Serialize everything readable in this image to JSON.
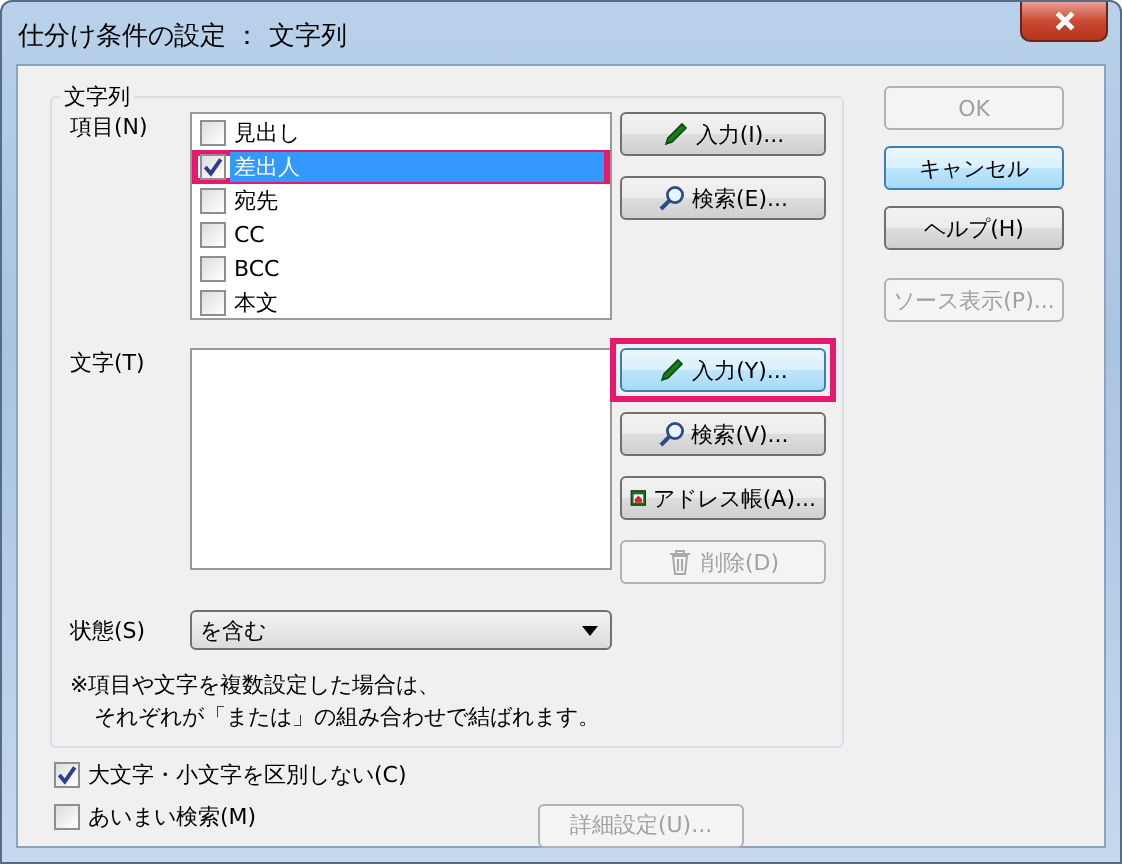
{
  "window": {
    "title": "仕分け条件の設定 ： 文字列"
  },
  "group": {
    "title": "文字列",
    "item_label": "項目(N)",
    "items": [
      {
        "label": "見出し",
        "checked": false,
        "selected": false,
        "highlighted": false
      },
      {
        "label": "差出人",
        "checked": true,
        "selected": true,
        "highlighted": true
      },
      {
        "label": "宛先",
        "checked": false,
        "selected": false,
        "highlighted": false
      },
      {
        "label": "CC",
        "checked": false,
        "selected": false,
        "highlighted": false
      },
      {
        "label": "BCC",
        "checked": false,
        "selected": false,
        "highlighted": false
      },
      {
        "label": "本文",
        "checked": false,
        "selected": false,
        "highlighted": false
      }
    ],
    "item_buttons": [
      {
        "label": "入力(I)...",
        "kind": "pencil",
        "disabled": false,
        "focused": false,
        "highlighted": false
      },
      {
        "label": "検索(E)...",
        "kind": "search",
        "disabled": false,
        "focused": false,
        "highlighted": false
      }
    ],
    "text_label": "文字(T)",
    "text_buttons": [
      {
        "label": "入力(Y)...",
        "kind": "pencil",
        "disabled": false,
        "focused": true,
        "highlighted": true
      },
      {
        "label": "検索(V)...",
        "kind": "search",
        "disabled": false,
        "focused": false,
        "highlighted": false
      },
      {
        "label": "アドレス帳(A)...",
        "kind": "addressbook",
        "disabled": false,
        "focused": false,
        "highlighted": false
      },
      {
        "label": "削除(D)",
        "kind": "trash",
        "disabled": true,
        "focused": false,
        "highlighted": false
      }
    ],
    "state_label": "状態(S)",
    "state_value": "を含む",
    "note_lines": [
      "※項目や文字を複数設定した場合は、",
      "それぞれが「または」の組み合わせで結ばれます。"
    ]
  },
  "options": [
    {
      "label": "大文字・小文字を区別しない(C)",
      "checked": true
    },
    {
      "label": "あいまい検索(M)",
      "checked": false
    }
  ],
  "detail_button": {
    "label": "詳細設定(U)...",
    "disabled": true
  },
  "side_buttons": [
    {
      "label": "OK",
      "disabled": true,
      "focused": false
    },
    {
      "label": "キャンセル",
      "disabled": false,
      "focused": true
    },
    {
      "label": "ヘルプ(H)",
      "disabled": false,
      "focused": false
    },
    {
      "label": "ソース表示(P)...",
      "disabled": true,
      "focused": false
    }
  ]
}
